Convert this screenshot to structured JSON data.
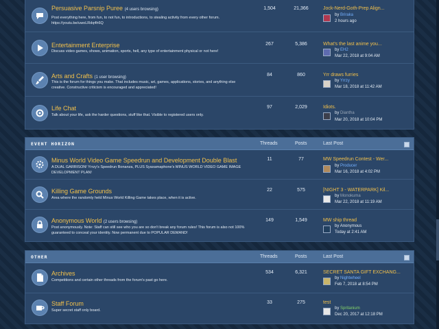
{
  "categories": [
    {
      "title": "",
      "forums": [
        {
          "icon": "bubble-icon",
          "title": "Persuasive Parsnip Puree",
          "browsing": "(4 users browsing)",
          "desc": "Post everything here, from fun, to not fun, to introductions, to stealing activity from every other forum. https://youtu.be/uwoLRdq4h6Q",
          "threads": "1,504",
          "posts": "21,366",
          "last_title": "Jock-Nerd-Goth-Prep Align...",
          "by": "by",
          "last_user": "Briraka",
          "last_date": "2 hours ago"
        },
        {
          "icon": "play-icon",
          "title": "Entertainment Enterprise",
          "browsing": "",
          "desc": "Discuss video games, shows, animation, sports, hell, any type of entertainment physical or not here!",
          "threads": "267",
          "posts": "5,386",
          "last_title": "What's the last anime you...",
          "by": "by",
          "last_user": "EH2",
          "last_date": "Mar 22, 2018 at 9:04 AM"
        },
        {
          "icon": "brush-icon",
          "title": "Arts and Crafts",
          "browsing": "(1 user browsing)",
          "desc": "This is the forum for things you make. That includes music, art, games, applications, stories, and anything else creative. Constructive criticism is encouraged and appreciated!",
          "threads": "84",
          "posts": "860",
          "last_title": "Yrr draws furries",
          "by": "by",
          "last_user": "Yrrzy",
          "last_date": "Mar 18, 2018 at 11:42 AM"
        },
        {
          "icon": "gear-icon",
          "title": "Life Chat",
          "browsing": "",
          "desc": "Talk about your life, ask the harder questions, stuff like that. Visible to registered users only.",
          "threads": "97",
          "posts": "2,029",
          "last_title": "Idiots.",
          "by": "by",
          "last_user": "Diantha",
          "last_date": "Mar 20, 2018 at 10:04 PM"
        }
      ]
    },
    {
      "title": "Event Horizon",
      "col_threads": "Threads",
      "col_posts": "Posts",
      "col_last": "Last Post",
      "forums": [
        {
          "icon": "gear-icon",
          "title": "Minus World Video Game Speedrun and Development Double Blast",
          "browsing": "",
          "desc": "A DUAL GARRISON! Yrrzy's Speedrun Bonanza, PLUS Syaxamaphone's MINUS WORLD VIDEO GAME IMAGE DEVELOPMENT PLAN!",
          "threads": "11",
          "posts": "77",
          "last_title": "MW Speedrun Contest - Wer...",
          "by": "by",
          "last_user": "Producer",
          "last_date": "Mar 16, 2018 at 4:02 PM"
        },
        {
          "icon": "magnifier-icon",
          "title": "Killing Game Grounds",
          "browsing": "",
          "desc": "Area where the randomly held Minus World Killing Game takes place, when it is active.",
          "threads": "22",
          "posts": "575",
          "last_title": "[NIGHT 3 - WATERPARK] Kil...",
          "by": "by",
          "last_user": "Monokuma",
          "last_date": "Mar 22, 2018 at 11:19 AM"
        },
        {
          "icon": "lock-icon",
          "title": "Anonymous World",
          "browsing": "(2 users browsing)",
          "desc": "Post anonymously. Note: Staff can still see who you are so don't break any forum rules! This forum is also not 100% guaranteed to conceal your identity. Now permanent due to POPULAR DEMAND!",
          "threads": "149",
          "posts": "1,549",
          "last_title": "MW ship thread",
          "by": "by",
          "last_user": "Anonymous",
          "last_date": "Today at 2:41 AM"
        }
      ]
    },
    {
      "title": "Other",
      "col_threads": "Threads",
      "col_posts": "Posts",
      "col_last": "Last Post",
      "forums": [
        {
          "icon": "document-icon",
          "title": "Archives",
          "browsing": "",
          "desc": "Competitions and certain other threads from the forum's past go here.",
          "threads": "534",
          "posts": "6,321",
          "last_title": "SECRET SANTA GIFT EXCHANG...",
          "by": "by",
          "last_user": "Nightwheel",
          "last_date": "Feb 7, 2018 at 8:54 PM"
        },
        {
          "icon": "mug-icon",
          "title": "Staff Forum",
          "browsing": "",
          "desc": "Super secret staff only board.",
          "threads": "33",
          "posts": "275",
          "last_title": "test",
          "by": "by",
          "last_user": "Spritanium",
          "last_date": "Dec 20, 2017 at 12:18 PM"
        }
      ]
    }
  ],
  "colors": {
    "accent": "#f3c14b",
    "link": "#74b0ff",
    "panel": "#2b4668",
    "header": "#4b6e98"
  }
}
